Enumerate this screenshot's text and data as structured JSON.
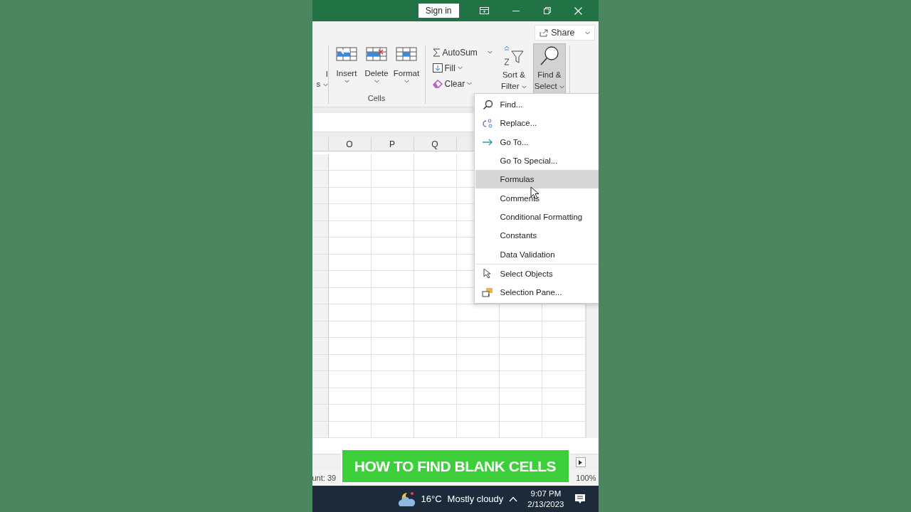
{
  "title_bar": {
    "sign_in": "Sign in"
  },
  "ribbon": {
    "share": "Share",
    "cut_group": [
      "l",
      "s"
    ],
    "cells_group": {
      "label": "Cells",
      "buttons": [
        {
          "label": "Insert"
        },
        {
          "label": "Delete"
        },
        {
          "label": "Format"
        }
      ]
    },
    "editing": {
      "small_buttons": [
        {
          "label": "AutoSum"
        },
        {
          "label": "Fill"
        },
        {
          "label": "Clear"
        }
      ],
      "large_buttons": [
        {
          "label": "Sort &",
          "label2": "Filter",
          "selected": false
        },
        {
          "label": "Find &",
          "label2": "Select",
          "selected": true
        }
      ]
    }
  },
  "sheet": {
    "columns": [
      "O",
      "P",
      "Q"
    ]
  },
  "menu": {
    "items": [
      {
        "label": "Find...",
        "has_icon": true,
        "selected": false,
        "separator_before": false
      },
      {
        "label": "Replace...",
        "has_icon": true,
        "selected": false,
        "separator_before": false
      },
      {
        "label": "Go To...",
        "has_icon": true,
        "selected": false,
        "separator_before": false
      },
      {
        "label": "Go To Special...",
        "has_icon": false,
        "selected": false,
        "separator_before": false
      },
      {
        "label": "Formulas",
        "has_icon": false,
        "selected": true,
        "separator_before": false
      },
      {
        "label": "Comments",
        "has_icon": false,
        "selected": false,
        "separator_before": false
      },
      {
        "label": "Conditional Formatting",
        "has_icon": false,
        "selected": false,
        "separator_before": false
      },
      {
        "label": "Constants",
        "has_icon": false,
        "selected": false,
        "separator_before": false
      },
      {
        "label": "Data Validation",
        "has_icon": false,
        "selected": false,
        "separator_before": false
      },
      {
        "label": "Select Objects",
        "has_icon": true,
        "selected": false,
        "separator_before": true
      },
      {
        "label": "Selection Pane...",
        "has_icon": true,
        "selected": false,
        "separator_before": false
      }
    ]
  },
  "status_bar": {
    "left": "unt: 39",
    "zoom": "100%"
  },
  "banner": "HOW TO FIND BLANK CELLS",
  "taskbar": {
    "temperature": "16°C",
    "weather": "Mostly cloudy",
    "time": "9:07 PM",
    "date": "2/13/2023"
  }
}
